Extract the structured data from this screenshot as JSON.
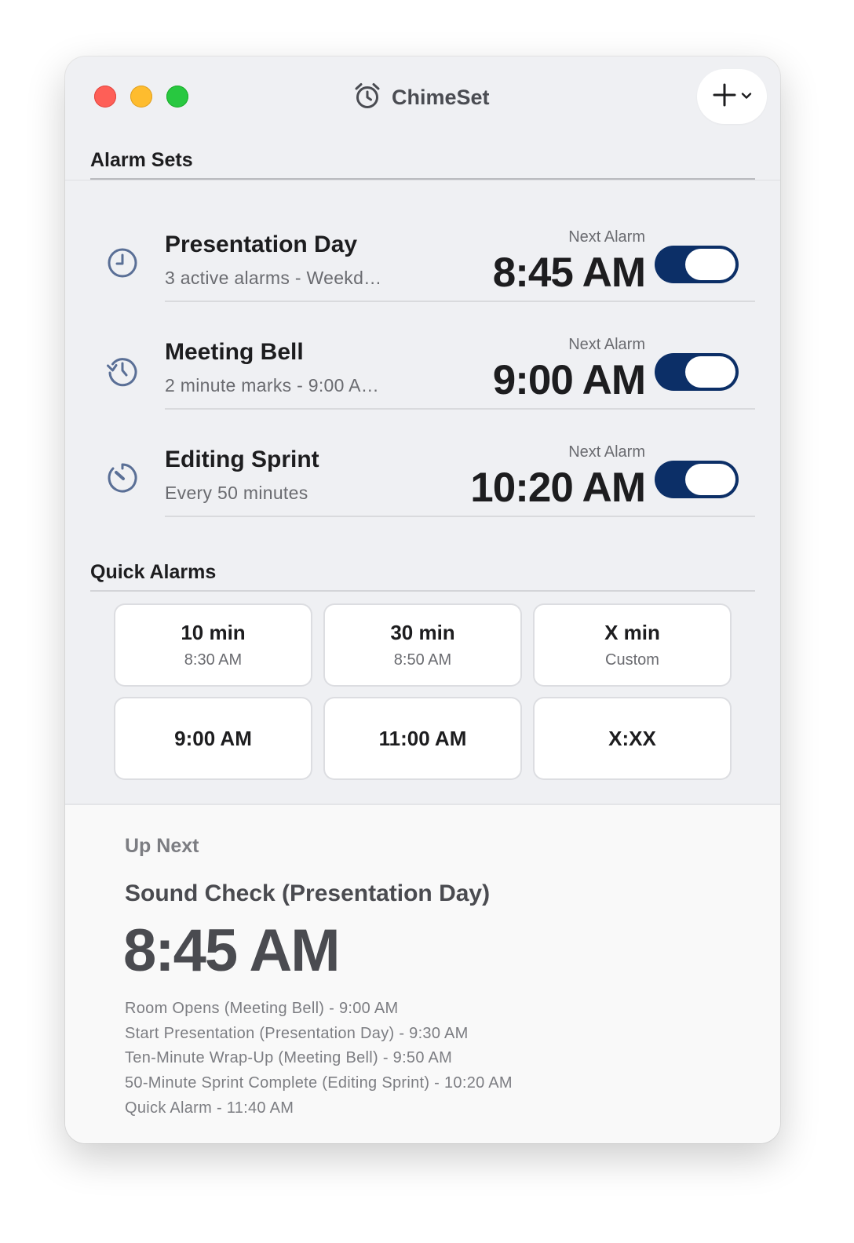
{
  "window": {
    "title": "ChimeSet",
    "app_icon": "alarm-clock-icon",
    "add_button_icon": "plus-icon",
    "add_menu_icon": "chevron-down-icon"
  },
  "alarm_sets": {
    "heading": "Alarm Sets",
    "items": [
      {
        "icon": "clock-icon",
        "title": "Presentation Day",
        "subtitle": "3 active alarms - Weekd…",
        "next_label": "Next Alarm",
        "time": "8:45 AM",
        "enabled": true
      },
      {
        "icon": "clock-history-icon",
        "title": "Meeting Bell",
        "subtitle": "2 minute marks - 9:00 A…",
        "next_label": "Next Alarm",
        "time": "9:00 AM",
        "enabled": true
      },
      {
        "icon": "timer-icon",
        "title": "Editing Sprint",
        "subtitle": "Every 50 minutes",
        "next_label": "Next Alarm",
        "time": "10:20 AM",
        "enabled": true
      }
    ]
  },
  "quick_alarms": {
    "heading": "Quick Alarms",
    "buttons": [
      {
        "label": "10 min",
        "detail": "8:30 AM"
      },
      {
        "label": "30 min",
        "detail": "8:50 AM"
      },
      {
        "label": "X min",
        "detail": "Custom"
      },
      {
        "label": "9:00 AM",
        "detail": ""
      },
      {
        "label": "11:00 AM",
        "detail": ""
      },
      {
        "label": "X:XX",
        "detail": ""
      }
    ]
  },
  "up_next": {
    "heading": "Up Next",
    "event": "Sound Check (Presentation Day)",
    "time": "8:45 AM",
    "upcoming": [
      "Room Opens (Meeting Bell) - 9:00 AM",
      "Start Presentation (Presentation Day) - 9:30 AM",
      "Ten-Minute Wrap-Up (Meeting Bell) - 9:50 AM",
      "50-Minute Sprint Complete (Editing Sprint) - 10:20 AM",
      "Quick Alarm - 11:40 AM"
    ]
  },
  "colors": {
    "toggle_on": "#0c2f67",
    "icon_tint": "#5a6f96",
    "traffic_red": "#fe5f57",
    "traffic_yellow": "#febc2e",
    "traffic_green": "#28c840"
  }
}
